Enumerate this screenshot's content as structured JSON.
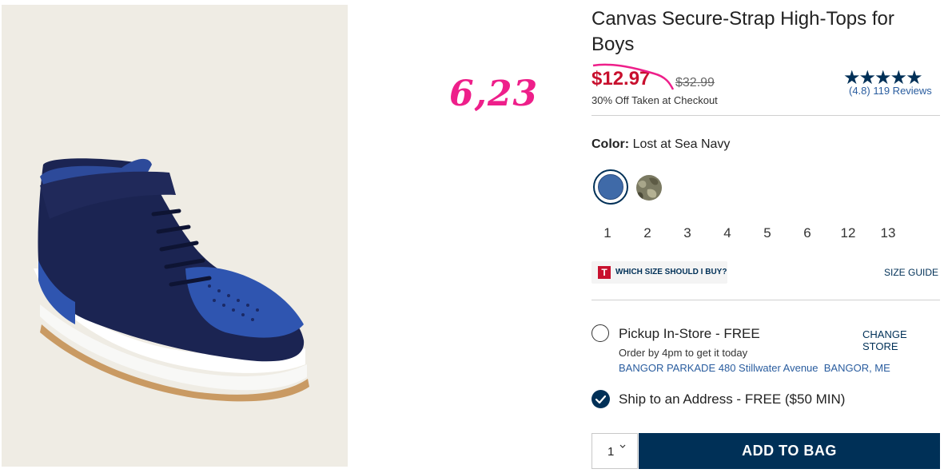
{
  "product": {
    "title": "Canvas Secure-Strap High-Tops for Boys",
    "sale_price": "$12.97",
    "original_price": "$32.99",
    "discount_note": "30% Off Taken at Checkout",
    "rating_text": "(4.8) 119 Reviews",
    "rating_value": 4.8,
    "stars": "★★★★★"
  },
  "annotation": "6,23",
  "color": {
    "label": "Color:",
    "value": "Lost at Sea Navy",
    "swatches": [
      "Lost at Sea Navy",
      "Camo"
    ]
  },
  "sizes": [
    "1",
    "2",
    "3",
    "4",
    "5",
    "6",
    "12",
    "13"
  ],
  "fit": {
    "logo": "T",
    "which_size": "WHICH SIZE SHOULD I BUY?",
    "size_guide": "SIZE GUIDE"
  },
  "fulfillment": {
    "pickup_title": "Pickup In-Store - FREE",
    "change_store": "CHANGE STORE",
    "order_by": "Order by 4pm to get it today",
    "store_address": "BANGOR PARKADE 480 Stillwater Avenue  BANGOR, ME",
    "ship_title": "Ship to an Address - FREE ($50 MIN)"
  },
  "cart": {
    "quantity": "1",
    "add_label": "ADD TO BAG"
  },
  "colors": {
    "navy": "#003057",
    "sale_red": "#c8102e",
    "annotation_pink": "#ee1f8a",
    "link_blue": "#2a5d9f"
  }
}
